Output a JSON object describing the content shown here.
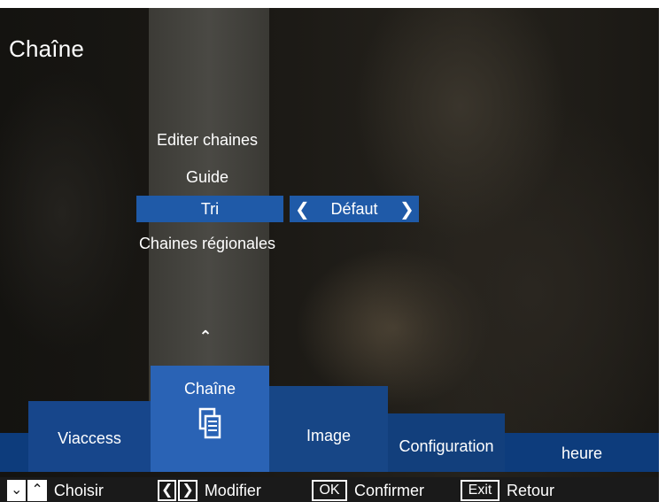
{
  "header": {
    "title": "Chaîne"
  },
  "menu": {
    "items": [
      {
        "label": "Editer chaines"
      },
      {
        "label": "Guide"
      },
      {
        "label": "Tri"
      },
      {
        "label": "Chaines régionales"
      }
    ],
    "selected": "Tri",
    "selected_value": "Défaut"
  },
  "tabs": [
    {
      "label": "Viaccess"
    },
    {
      "label": "Chaîne"
    },
    {
      "label": "Image"
    },
    {
      "label": "Configuration"
    },
    {
      "label": "heure"
    }
  ],
  "icons": {
    "scroll_up": "chevron-up-icon",
    "value_prev": "chevron-left-icon",
    "value_next": "chevron-right-icon",
    "active_tab": "documents-icon"
  },
  "footer": {
    "choose_label": "Choisir",
    "modify_label": "Modifier",
    "ok_key": "OK",
    "confirm_label": "Confirmer",
    "exit_key": "Exit",
    "back_label": "Retour"
  },
  "colors": {
    "highlight": "#1f5aa8",
    "active_tab": "#2a63b5",
    "tab_band": "#0d3c7c"
  }
}
